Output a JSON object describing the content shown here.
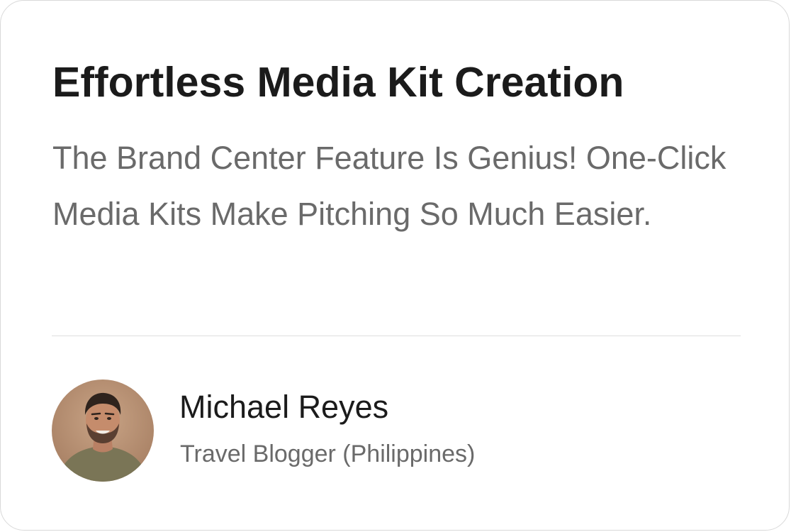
{
  "testimonial": {
    "title": "Effortless Media Kit Creation",
    "quote": "The Brand Center Feature Is Genius! One-Click Media Kits Make Pitching So Much Easier.",
    "author": {
      "name": "Michael Reyes",
      "role": "Travel Blogger (Philippines)",
      "avatar_icon": "person-photo"
    }
  }
}
